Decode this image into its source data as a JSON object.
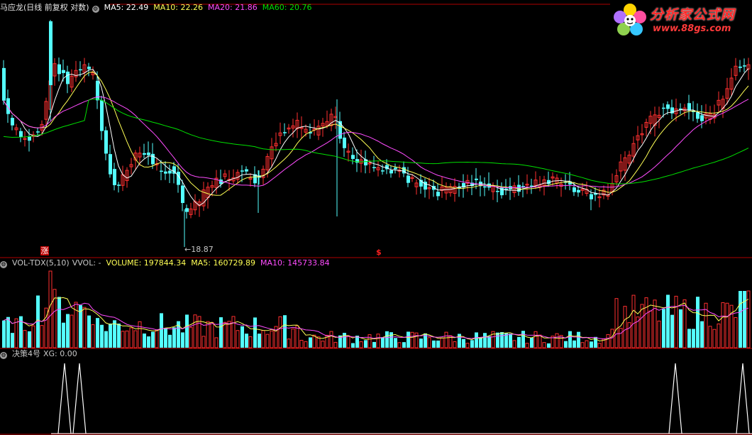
{
  "price_panel": {
    "title": "马应龙(日线 前复权 对数)",
    "ma5": "MA5: 22.49",
    "ma10": "MA10: 22.26",
    "ma20": "MA20: 21.86",
    "ma60": "MA60: 20.76",
    "low_label": "←18.87",
    "mark_zhang": "涨",
    "mark_s": "$"
  },
  "volume_panel": {
    "indicator": "VOL-TDX(5,10)",
    "vvol": "VVOL: -",
    "volume": "VOLUME: 197844.34",
    "ma5": "MA5: 160729.89",
    "ma10": "MA10: 145733.84"
  },
  "xg_panel": {
    "indicator": "决策4号",
    "xg": "XG: 0.00",
    "signal_columns": [
      91,
      112,
      952,
      1047
    ]
  },
  "watermark": {
    "name": "分析家公式网",
    "url": "www.88gs.com"
  },
  "colors": {
    "up": "#ff3030",
    "down": "#54ffff",
    "ma5": "#ffffff",
    "ma10": "#ffff55",
    "ma20": "#ff4cff",
    "ma60": "#00e000",
    "grid": "#b00000"
  },
  "icons": {
    "settings": "gear-icon"
  }
}
